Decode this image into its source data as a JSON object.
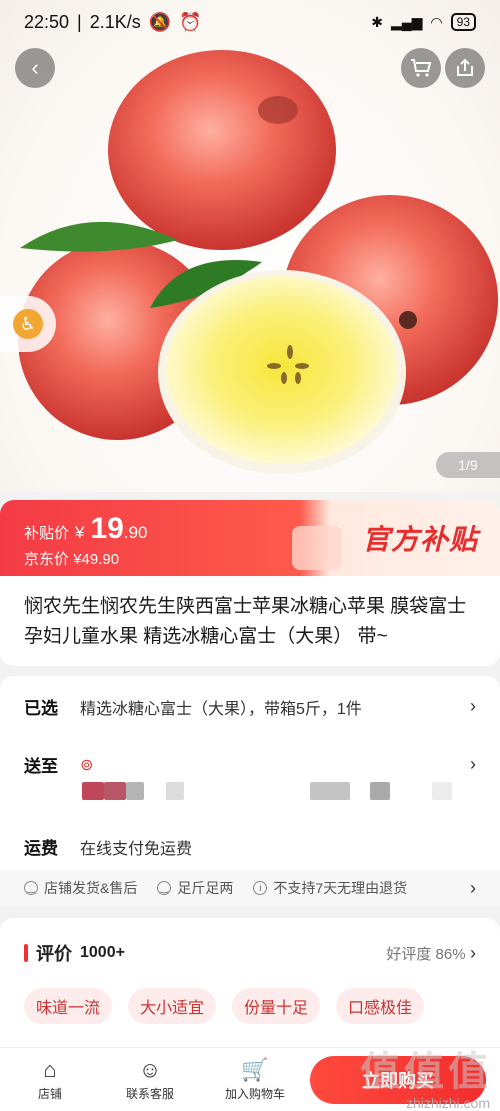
{
  "status_bar": {
    "time": "22:50",
    "speed": "2.1K/s",
    "battery": "93"
  },
  "hero": {
    "page_indicator": "1/9"
  },
  "price": {
    "subsidy_label": "补贴价",
    "currency": "¥",
    "subsidy_int": "19",
    "subsidy_dec": ".90",
    "jd_label": "京东价",
    "jd_price": "¥49.90",
    "badge": "官方补贴"
  },
  "product": {
    "title": "悯农先生悯农先生陕西富士苹果冰糖心苹果 膜袋富士 孕妇儿童水果 精选冰糖心富士（大果） 带~"
  },
  "info": {
    "selected_label": "已选",
    "selected_value": "精选冰糖心富士（大果），带箱5斤，1件",
    "ship_label": "送至",
    "shipping_label": "运费",
    "shipping_value": "在线支付免运费",
    "services": [
      "店铺发货&售后",
      "足斤足两",
      "不支持7天无理由退货"
    ]
  },
  "reviews": {
    "title": "评价",
    "count": "1000+",
    "rating": "好评度 86%",
    "tags": [
      "味道一流",
      "大小适宜",
      "份量十足",
      "口感极佳"
    ]
  },
  "bottom_bar": {
    "shop": "店铺",
    "service": "联系客服",
    "cart": "加入购物车",
    "buy": "立即购买"
  },
  "watermark": {
    "text": "值",
    "url": "zhizhizhi.com"
  },
  "colors": {
    "accent": "#f23030",
    "banner": "#ff5a4c"
  }
}
